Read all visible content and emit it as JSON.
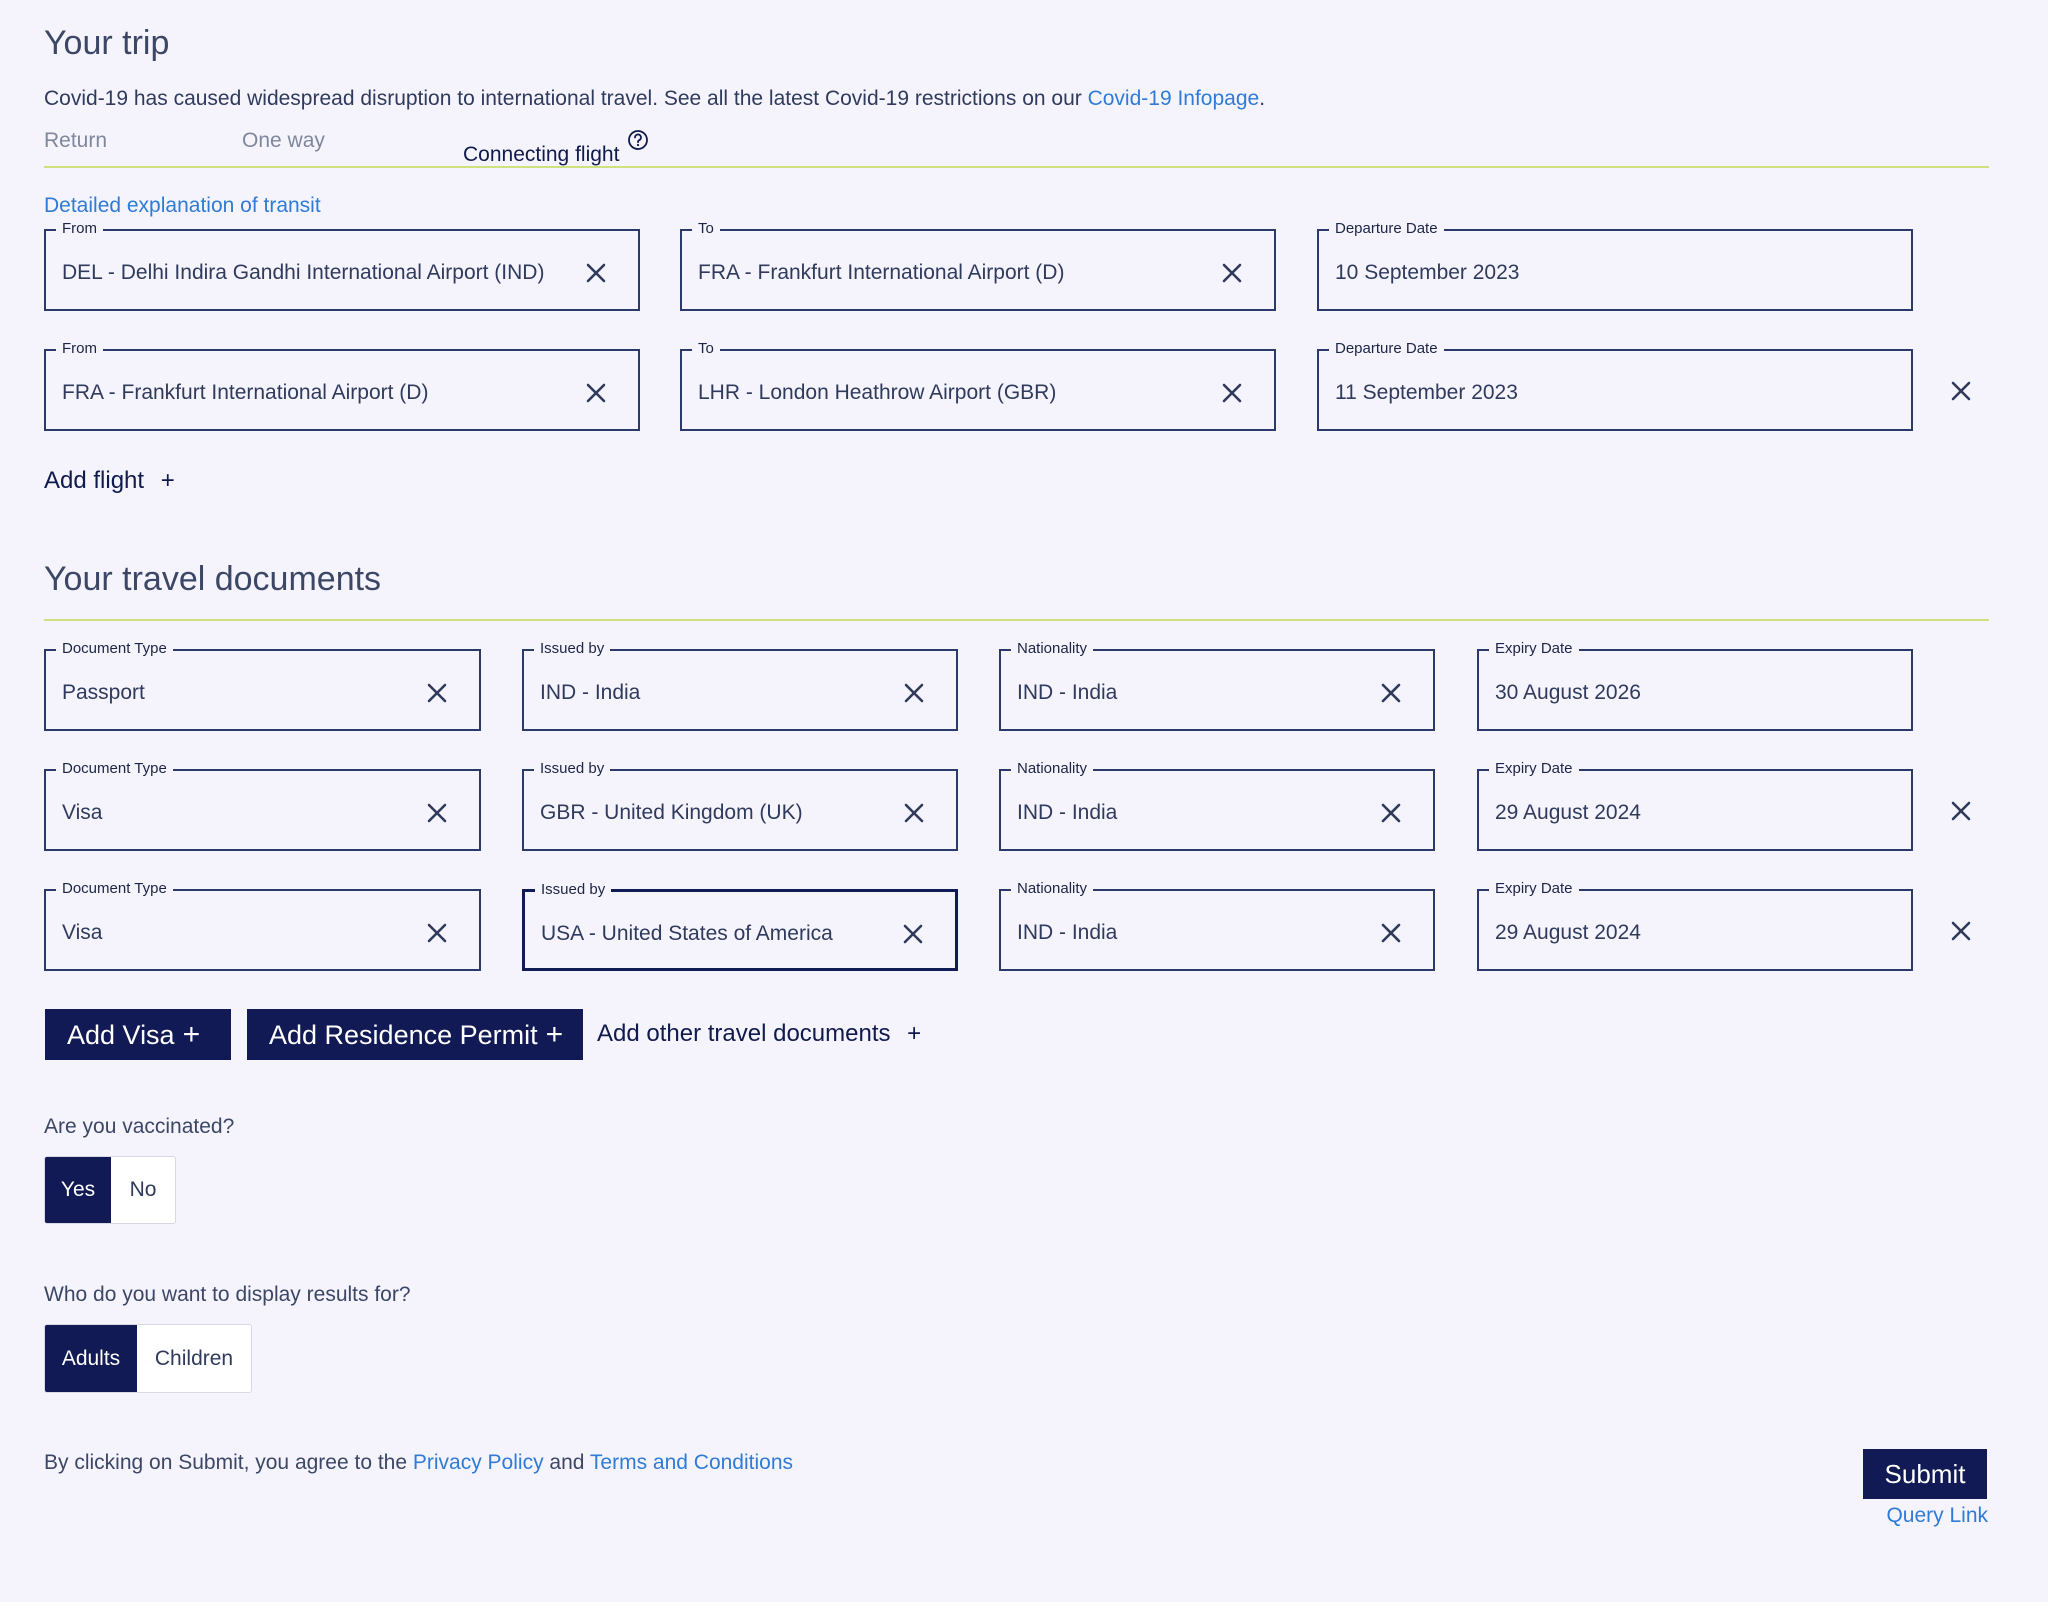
{
  "trip": {
    "title": "Your trip",
    "notice_text": "Covid-19 has caused widespread disruption to international travel. See all the latest Covid-19 restrictions on our ",
    "notice_link": "Covid-19 Infopage",
    "notice_end": ".",
    "tabs": [
      {
        "label": "Return",
        "active": false
      },
      {
        "label": "One way",
        "active": false
      },
      {
        "label": "Connecting flight",
        "active": true
      }
    ],
    "help_icon": "question-circle-icon",
    "transit_link": "Detailed explanation of transit",
    "flights": [
      {
        "from_label": "From",
        "from": "DEL - Delhi Indira Gandhi International Airport (IND)",
        "to_label": "To",
        "to": "FRA - Frankfurt International Airport (D)",
        "date_label": "Departure Date",
        "date": "10 September 2023"
      },
      {
        "from_label": "From",
        "from": "FRA - Frankfurt International Airport (D)",
        "to_label": "To",
        "to": "LHR - London Heathrow Airport (GBR)",
        "date_label": "Departure Date",
        "date": "11 September 2023"
      }
    ],
    "add_flight": "Add flight",
    "add_icon": "+"
  },
  "documents": {
    "title": "Your travel documents",
    "rows": [
      {
        "type_label": "Document Type",
        "type": "Passport",
        "issued_label": "Issued by",
        "issued": "IND - India",
        "nat_label": "Nationality",
        "nat": "IND - India",
        "exp_label": "Expiry Date",
        "exp": "30 August 2026"
      },
      {
        "type_label": "Document Type",
        "type": "Visa",
        "issued_label": "Issued by",
        "issued": "GBR - United Kingdom (UK)",
        "nat_label": "Nationality",
        "nat": "IND - India",
        "exp_label": "Expiry Date",
        "exp": "29 August 2024"
      },
      {
        "type_label": "Document Type",
        "type": "Visa",
        "issued_label": "Issued by",
        "issued": "USA - United States of America",
        "nat_label": "Nationality",
        "nat": "IND - India",
        "exp_label": "Expiry Date",
        "exp": "29 August 2024"
      }
    ],
    "add_visa": "Add Visa",
    "add_residence": "Add Residence Permit",
    "add_other": "Add other travel documents",
    "plus": "+"
  },
  "vaccinated": {
    "question": "Are you vaccinated?",
    "options": [
      "Yes",
      "No"
    ],
    "selected": "Yes"
  },
  "audience": {
    "question": "Who do you want to display results for?",
    "options": [
      "Adults",
      "Children"
    ],
    "selected": "Adults"
  },
  "footer": {
    "consent_prefix": "By clicking on Submit, you agree to the ",
    "privacy": "Privacy Policy",
    "and": " and ",
    "terms": "Terms and Conditions",
    "submit": "Submit",
    "query_link": "Query Link"
  },
  "colors": {
    "accent_dark": "#111a54",
    "link": "#2f7bd6",
    "divider": "#cfe07e",
    "background": "#f5f4fd"
  }
}
